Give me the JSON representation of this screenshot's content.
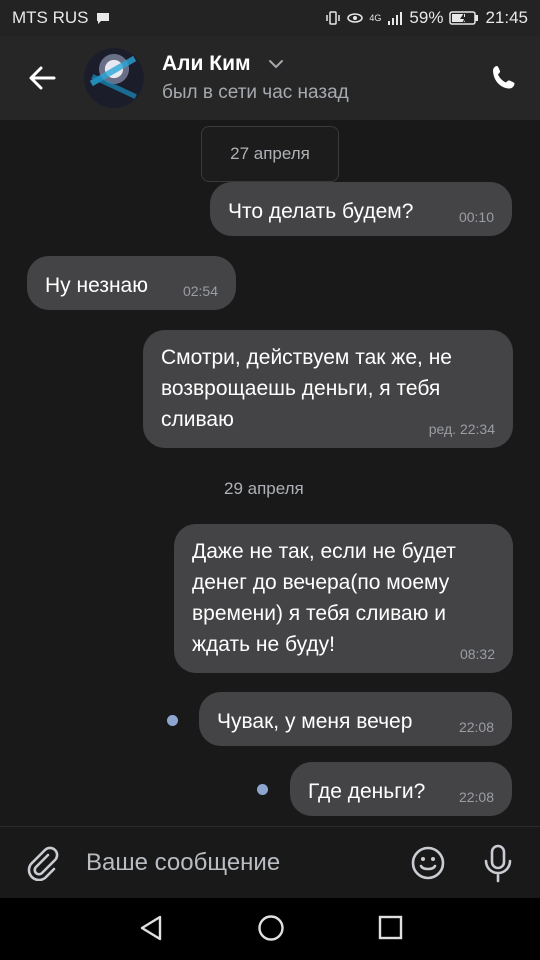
{
  "status_bar": {
    "carrier": "MTS RUS",
    "network": "4G",
    "battery": "59%",
    "time": "21:45"
  },
  "header": {
    "name": "Али Ким",
    "status": "был в сети час назад"
  },
  "dates": [
    "27 апреля",
    "29 апреля"
  ],
  "messages": [
    {
      "text": "Что делать будем?",
      "time": "00:10"
    },
    {
      "text": "Ну незнаю",
      "time": "02:54"
    },
    {
      "text": "Смотри, действуем так же, не возврощаешь деньги, я тебя сливаю",
      "time": "ред. 22:34"
    },
    {
      "text": "Даже не так, если не будет денег до вечера(по моему времени) я тебя сливаю и ждать не буду!",
      "time": "08:32"
    },
    {
      "text": "Чувак, у меня вечер",
      "time": "22:08"
    },
    {
      "text": "Где деньги?",
      "time": "22:08"
    }
  ],
  "composer": {
    "placeholder": "Ваше сообщение"
  },
  "colors": {
    "background": "#19191a",
    "bubble": "#444446",
    "unread_dot": "#8ea6cf"
  }
}
